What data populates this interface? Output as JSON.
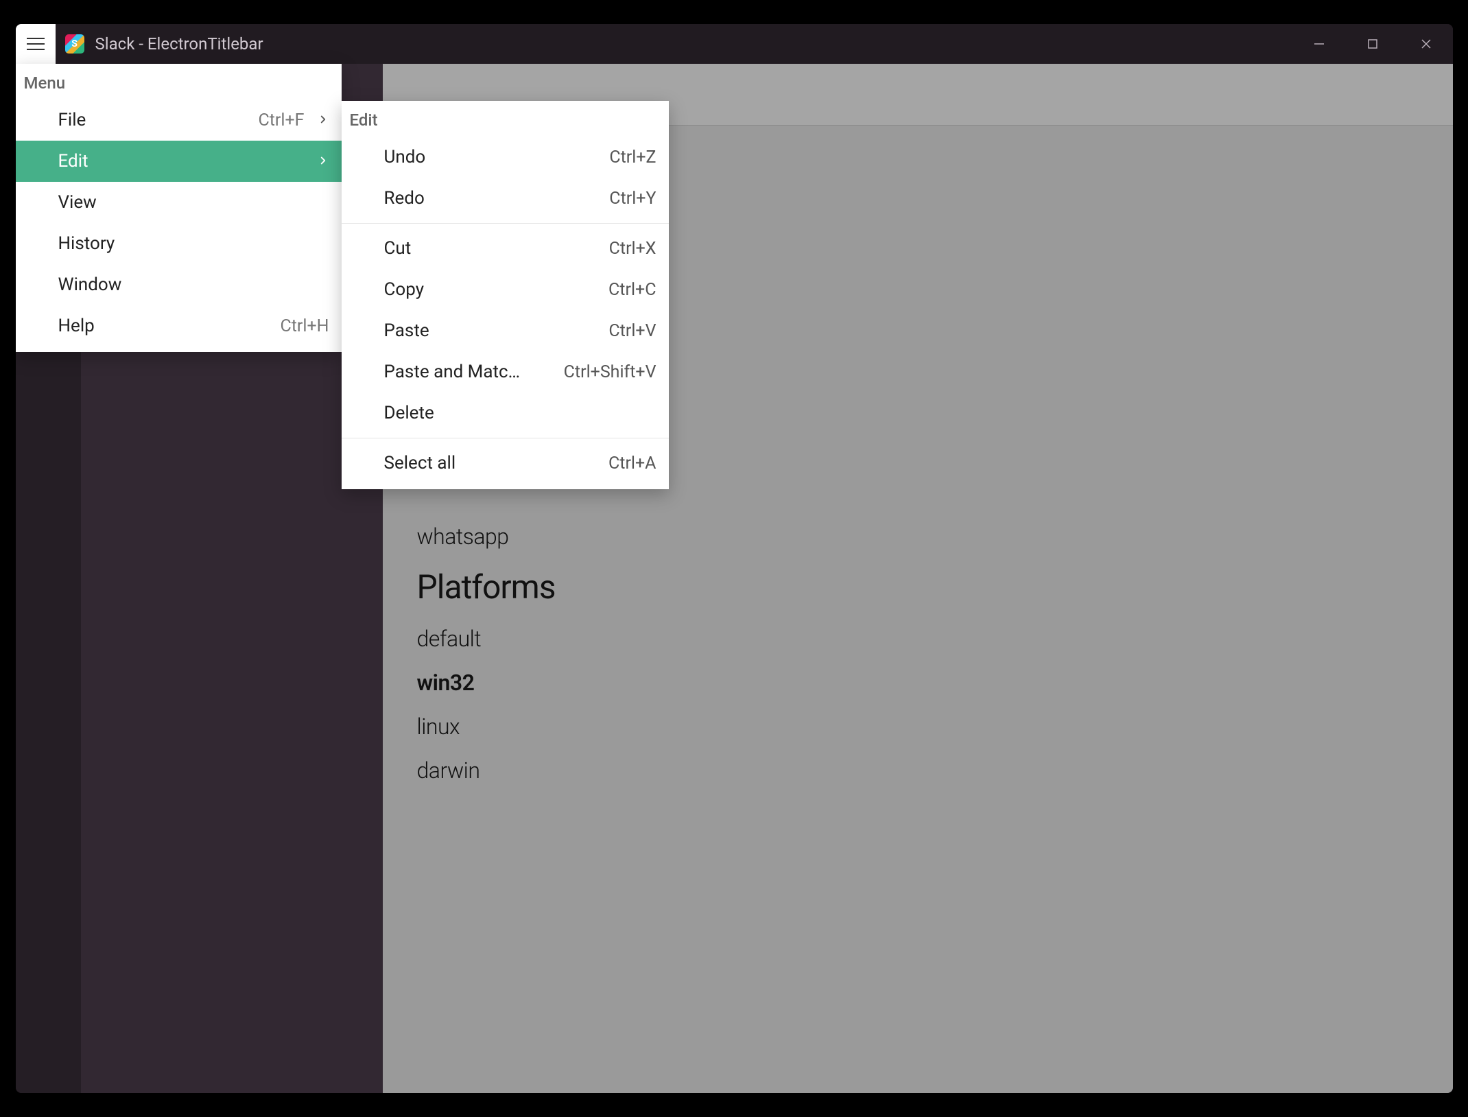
{
  "titlebar": {
    "title": "Slack - ElectronTitlebar",
    "icon_letter": "S"
  },
  "menu": {
    "header": "Menu",
    "items": [
      {
        "label": "File",
        "shortcut": "Ctrl+F",
        "has_submenu": true,
        "active": false
      },
      {
        "label": "Edit",
        "shortcut": "",
        "has_submenu": true,
        "active": true
      },
      {
        "label": "View",
        "shortcut": "",
        "has_submenu": false,
        "active": false
      },
      {
        "label": "History",
        "shortcut": "",
        "has_submenu": false,
        "active": false
      },
      {
        "label": "Window",
        "shortcut": "",
        "has_submenu": false,
        "active": false
      },
      {
        "label": "Help",
        "shortcut": "Ctrl+H",
        "has_submenu": false,
        "active": false
      }
    ]
  },
  "submenu": {
    "header": "Edit",
    "groups": [
      [
        {
          "label": "Undo",
          "shortcut": "Ctrl+Z"
        },
        {
          "label": "Redo",
          "shortcut": "Ctrl+Y"
        }
      ],
      [
        {
          "label": "Cut",
          "shortcut": "Ctrl+X"
        },
        {
          "label": "Copy",
          "shortcut": "Ctrl+C"
        },
        {
          "label": "Paste",
          "shortcut": "Ctrl+V"
        },
        {
          "label": "Paste and Match …",
          "shortcut": "Ctrl+Shift+V"
        },
        {
          "label": "Delete",
          "shortcut": ""
        }
      ],
      [
        {
          "label": "Select all",
          "shortcut": "Ctrl+A"
        }
      ]
    ]
  },
  "content": {
    "visible_items_top": [
      {
        "label": "whatsapp",
        "bold": false
      }
    ],
    "heading": "Platforms",
    "platforms": [
      {
        "label": "default",
        "bold": false
      },
      {
        "label": "win32",
        "bold": true
      },
      {
        "label": "linux",
        "bold": false
      },
      {
        "label": "darwin",
        "bold": false
      }
    ]
  }
}
